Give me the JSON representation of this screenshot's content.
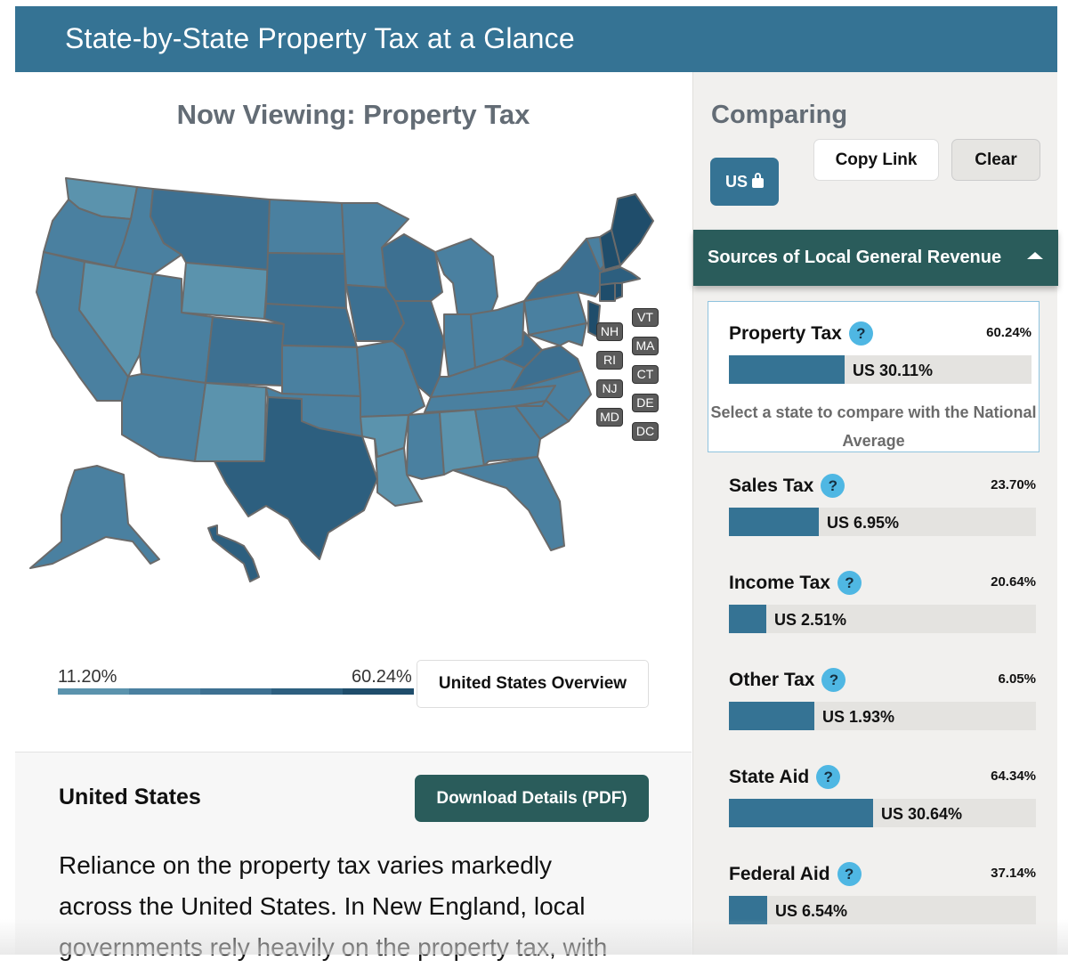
{
  "header": {
    "title": "State-by-State Property Tax at a Glance"
  },
  "main": {
    "now_viewing": "Now Viewing: Property Tax",
    "small_states": [
      "VT",
      "NH",
      "MA",
      "RI",
      "CT",
      "NJ",
      "DE",
      "MD",
      "DC"
    ],
    "legend": {
      "min": "11.20%",
      "max": "60.24%",
      "colors": [
        "#5b93ad",
        "#4a80a0",
        "#3d7091",
        "#2d5f7f",
        "#1f4d6b"
      ]
    },
    "us_overview_label": "United States Overview",
    "info": {
      "title": "United States",
      "download_label": "Download Details (PDF)",
      "text": "Reliance on the property tax varies markedly across the United States. In New England, local governments rely heavily on the property tax, with"
    }
  },
  "map_colors": {
    "c1": "#5b93ad",
    "c2": "#4a80a0",
    "c3": "#3d7091",
    "c4": "#2d5f7f",
    "c5": "#1f4d6b",
    "border": "#6a6a6a"
  },
  "sidebar": {
    "comparing_label": "Comparing",
    "us_chip_label": "US",
    "copy_link_label": "Copy Link",
    "clear_label": "Clear",
    "section_title": "Sources of Local General Revenue",
    "select_hint": "Select a state to compare with the National Average",
    "metrics": [
      {
        "name": "Property Tax",
        "max": "60.24%",
        "us": "US 30.11%",
        "fraction": 0.383
      },
      {
        "name": "Sales Tax",
        "max": "23.70%",
        "us": "US 6.95%",
        "fraction": 0.293
      },
      {
        "name": "Income Tax",
        "max": "20.64%",
        "us": "US 2.51%",
        "fraction": 0.122
      },
      {
        "name": "Other Tax",
        "max": "6.05%",
        "us": "US 1.93%",
        "fraction": 0.279
      },
      {
        "name": "State Aid",
        "max": "64.34%",
        "us": "US 30.64%",
        "fraction": 0.471
      },
      {
        "name": "Federal Aid",
        "max": "37.14%",
        "us": "US 6.54%",
        "fraction": 0.125
      }
    ]
  }
}
